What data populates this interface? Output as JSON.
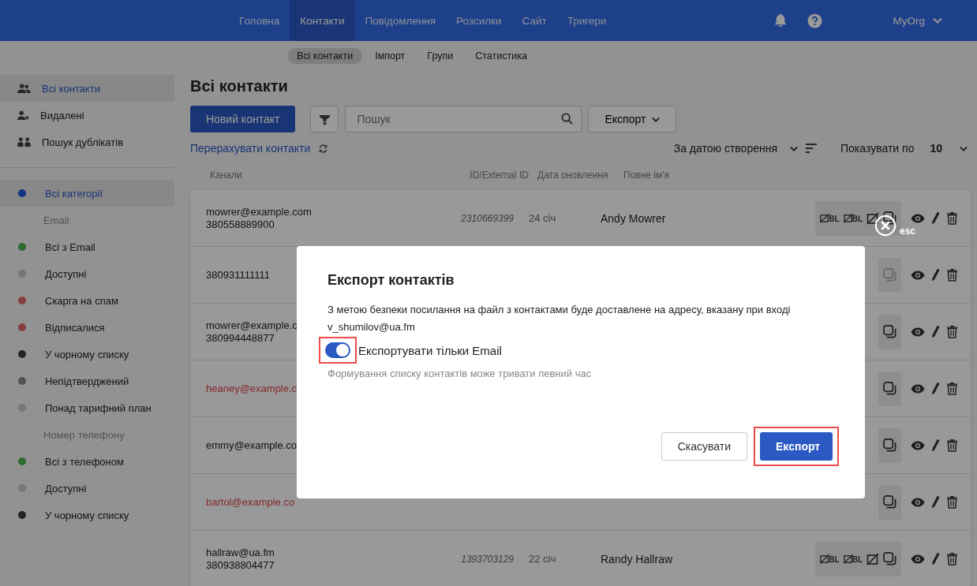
{
  "nav": {
    "items": [
      {
        "label": "Головна",
        "selected": false
      },
      {
        "label": "Контакти",
        "selected": true
      },
      {
        "label": "Повідомлення",
        "selected": false
      },
      {
        "label": "Розсилки",
        "selected": false
      },
      {
        "label": "Сайт",
        "selected": false
      },
      {
        "label": "Тригери",
        "selected": false
      }
    ],
    "org": "MyOrg"
  },
  "subnav": [
    {
      "label": "Всі контакти",
      "selected": true
    },
    {
      "label": "Імпорт",
      "selected": false
    },
    {
      "label": "Групи",
      "selected": false
    },
    {
      "label": "Статистика",
      "selected": false
    }
  ],
  "sidebar": {
    "items": [
      {
        "label": "Всі контакти",
        "selected": true
      },
      {
        "label": "Видалені",
        "selected": false
      },
      {
        "label": "Пошук дублікатів",
        "selected": false
      }
    ],
    "categories": [
      {
        "kind": "item",
        "label": "Всі категорії",
        "color": "#133480",
        "selected": true
      },
      {
        "kind": "header",
        "label": "Email"
      },
      {
        "kind": "item",
        "label": "Всі з Email",
        "color": "#2e6930",
        "selected": false
      },
      {
        "kind": "item",
        "label": "Доступні",
        "color": "#767676",
        "selected": false
      },
      {
        "kind": "item",
        "label": "Скарга на спам",
        "color": "#863d3d",
        "selected": false
      },
      {
        "kind": "item",
        "label": "Відписалися",
        "color": "#863d3d",
        "selected": false
      },
      {
        "kind": "item",
        "label": "У чорному списку",
        "color": "#252525",
        "selected": false
      },
      {
        "kind": "item",
        "label": "Непідтверджений",
        "color": "#535353",
        "selected": false
      },
      {
        "kind": "item",
        "label": "Понад тарифний план",
        "color": "#767676",
        "selected": false
      },
      {
        "kind": "header",
        "label": "Номер телефону"
      },
      {
        "kind": "item",
        "label": "Всі з телефоном",
        "color": "#2e6930",
        "selected": false
      },
      {
        "kind": "item",
        "label": "Доступні",
        "color": "#767676",
        "selected": false
      },
      {
        "kind": "item",
        "label": "У чорному списку",
        "color": "#252525",
        "selected": false
      }
    ]
  },
  "main": {
    "title": "Всі контакти",
    "new_button": "Новий контакт",
    "search": {
      "placeholder": "Пошук"
    },
    "export_button": "Експорт",
    "recount_link": "Перерахувати контакти",
    "sort": "За датою створення",
    "page_size": {
      "label": "Показувати по",
      "value": "10"
    },
    "columns": [
      "Канали",
      "ID/External ID",
      "Дата оновлення",
      "Повне ім'я"
    ],
    "rows": [
      {
        "channels": [
          {
            "text": "mowrer@example.com",
            "error": false
          },
          {
            "text": "380558889900",
            "error": false
          }
        ],
        "id": "2310669399",
        "date": "24 січ",
        "name": "Andy Mowrer",
        "status_icons": [
          {
            "kind": "blacklist",
            "label": "BL",
            "disabled": false
          },
          {
            "kind": "blacklist",
            "label": "BL",
            "disabled": false
          },
          {
            "kind": "no-message",
            "disabled": false
          },
          {
            "kind": "copies",
            "disabled": false
          }
        ]
      },
      {
        "channels": [
          {
            "text": "380931111111",
            "error": false
          }
        ],
        "status_icons": [
          {
            "kind": "copies",
            "disabled": true
          }
        ]
      },
      {
        "channels": [
          {
            "text": "mowrer@example.c",
            "error": false
          },
          {
            "text": "380994448877",
            "error": false
          }
        ],
        "status_icons": [
          {
            "kind": "copies",
            "disabled": false
          }
        ]
      },
      {
        "channels": [
          {
            "text": "heaney@example.c",
            "error": true
          }
        ],
        "status_icons": [
          {
            "kind": "copies",
            "disabled": false
          }
        ]
      },
      {
        "channels": [
          {
            "text": "emmy@example.co",
            "error": false
          }
        ],
        "status_icons": [
          {
            "kind": "copies",
            "disabled": false
          }
        ]
      },
      {
        "channels": [
          {
            "text": "bartol@example.co",
            "error": true
          }
        ],
        "status_icons": [
          {
            "kind": "copies",
            "disabled": false
          }
        ]
      },
      {
        "channels": [
          {
            "text": "hallraw@ua.fm",
            "error": false
          },
          {
            "text": "380938804477",
            "error": false
          }
        ],
        "id": "1393703129",
        "date": "22 січ",
        "name": "Randy Hallraw",
        "status_icons": [
          {
            "kind": "blacklist",
            "label": "BL",
            "disabled": false
          },
          {
            "kind": "blacklist",
            "label": "BL",
            "disabled": false
          },
          {
            "kind": "no-message",
            "disabled": false
          },
          {
            "kind": "copies",
            "disabled": false
          }
        ]
      }
    ]
  },
  "close": {
    "label": "esc"
  },
  "modal": {
    "title": "Експорт контактів",
    "message": "З метою безпеки посилання на файл з контактами буде доставлене на адресу, вказану при вході",
    "address": "v_shumilov@ua.fm",
    "toggle": {
      "label": "Експортувати тільки Email",
      "on": true,
      "highlighted": true
    },
    "hint": "Формування списку контактів може тривати певний час",
    "buttons": [
      {
        "label": "Скасувати",
        "kind": "secondary",
        "highlighted": false
      },
      {
        "label": "Експорт",
        "kind": "primary",
        "highlighted": true
      }
    ]
  }
}
